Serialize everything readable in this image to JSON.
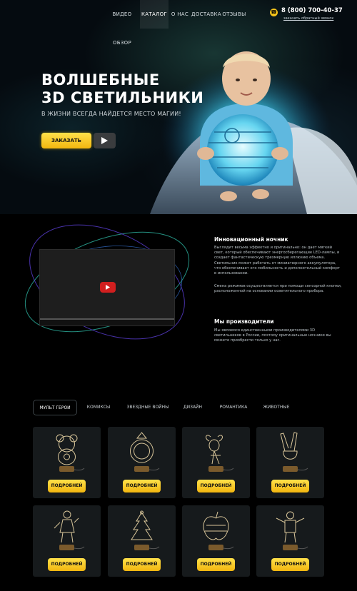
{
  "nav": {
    "items": [
      {
        "label": "ВИДЕО ОБЗОР",
        "active": false
      },
      {
        "label": "КАТАЛОГ",
        "active": true
      },
      {
        "label": "О НАС",
        "active": false
      },
      {
        "label": "ДОСТАВКА",
        "active": false
      },
      {
        "label": "ОТЗЫВЫ",
        "active": false
      }
    ],
    "phone": "8 (800) 700-40-37",
    "callback": "заказать обратный звонок",
    "phone_icon": "phone-icon"
  },
  "hero": {
    "title_line1": "ВОЛШЕБНЫЕ",
    "title_line2": "3D СВЕТИЛЬНИКИ",
    "subtitle": "В ЖИЗНИ ВСЕГДА НАЙДЕТСЯ МЕСТО МАГИИ!",
    "order_label": "ЗАКАЗАТЬ",
    "play_icon": "play-icon"
  },
  "about": {
    "section1_title": "Инновационный ночник",
    "section1_p1": "Выглядит весьма эффектно и оригинально: он дает мягкий свет, который обеспечивают энергосберегающие LED-лампы, и создает фантастическую трехмерную иллюзию объема. Светильник может работать от миниатюрного аккумулятора, что обеспечивает его мобильность и дополнительный комфорт в использовании.",
    "section1_p2": "Смена режимов осуществляется при помощи сенсорной кнопки, расположенной на основании осветительного прибора.",
    "section2_title": "Мы производители",
    "section2_p1": "Мы являемся единственными производителями 3D светильников в России, поэтому оригинальные ночники вы можете приобрести только у нас."
  },
  "catalog": {
    "tabs": [
      {
        "label": "МУЛЬТ ГЕРОИ",
        "active": true
      },
      {
        "label": "КОМИКСЫ",
        "active": false
      },
      {
        "label": "ЗВЕЗДНЫЕ ВОЙНЫ",
        "active": false
      },
      {
        "label": "ДИЗАЙН",
        "active": false
      },
      {
        "label": "РОМАНТИКА",
        "active": false
      },
      {
        "label": "ЖИВОТНЫЕ",
        "active": false
      }
    ],
    "products": [
      {
        "icon": "teddy-bear-lamp-icon",
        "button": "ПОДРОБНЕЙ"
      },
      {
        "icon": "ring-lamp-icon",
        "button": "ПОДРОБНЕЙ"
      },
      {
        "icon": "goat-lamp-icon",
        "button": "ПОДРОБНЕЙ"
      },
      {
        "icon": "victory-hand-lamp-icon",
        "button": "ПОДРОБНЕЙ"
      },
      {
        "icon": "hero-figure-lamp-icon",
        "button": "ПОДРОБНЕЙ"
      },
      {
        "icon": "christmas-tree-lamp-icon",
        "button": "ПОДРОБНЕЙ"
      },
      {
        "icon": "apple-lamp-icon",
        "button": "ПОДРОБНЕЙ"
      },
      {
        "icon": "robot-figure-lamp-icon",
        "button": "ПОДРОБНЕЙ"
      }
    ]
  },
  "colors": {
    "accent": "#f6c31a",
    "background": "#000000",
    "card": "#161a1c",
    "youtube_red": "#d11f1f"
  }
}
